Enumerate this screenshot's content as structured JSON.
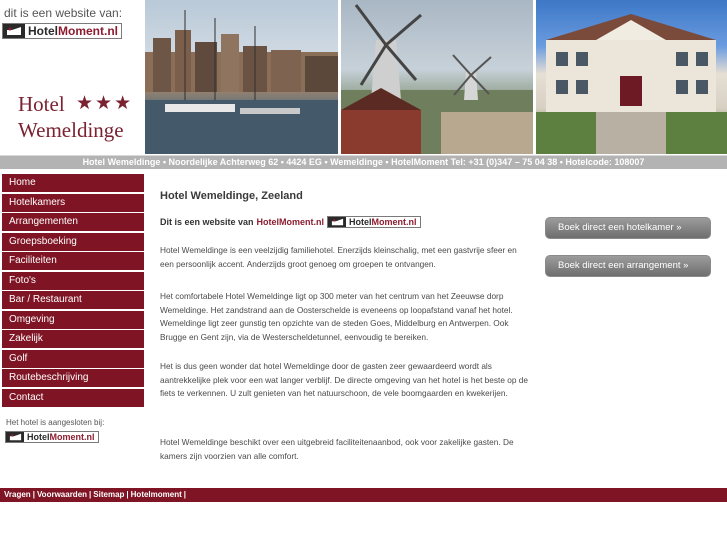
{
  "header": {
    "tagline": "dit is een website van:",
    "logo": {
      "part_a": "Hotel",
      "part_b": "Moment.nl"
    },
    "hotel_name": "Hotel",
    "hotel_stars": "★★★",
    "hotel_place": "Wemeldinge",
    "address_line": "Hotel Wemeldinge • Noordelijke Achterweg 62 • 4424 EG • Wemeldinge • HotelMoment Tel: +31 (0)347 – 75 04 38 • Hotelcode: 108007"
  },
  "nav": {
    "items": [
      {
        "label": "Home"
      },
      {
        "label": "Hotelkamers"
      },
      {
        "label": "Arrangementen"
      },
      {
        "label": "Groepsboeking"
      },
      {
        "label": "Faciliteiten"
      },
      {
        "label": "Foto's"
      },
      {
        "label": "Bar / Restaurant"
      },
      {
        "label": "Omgeving"
      },
      {
        "label": "Zakelijk"
      },
      {
        "label": "Golf"
      },
      {
        "label": "Routebeschrijving"
      },
      {
        "label": "Contact"
      }
    ],
    "member_text": "Het hotel is aangesloten bij:"
  },
  "main": {
    "title": "Hotel Wemeldinge, Zeeland",
    "intro_text": "Dit is een website van",
    "intro_link": "HotelMoment.nl",
    "paragraphs": [
      "Hotel Wemeldinge is een veelzijdig familiehotel. Enerzijds kleinschalig, met een gastvrije sfeer en een persoonlijk accent. Anderzijds groot genoeg om groepen te ontvangen.",
      "Het comfortabele Hotel Wemeldinge ligt op 300 meter van het centrum van het Zeeuwse dorp Wemeldinge. Het zandstrand aan de Oosterschelde is eveneens op loopafstand vanaf het hotel. Wemeldinge ligt zeer gunstig ten opzichte van de steden Goes, Middelburg en Antwerpen. Ook Brugge en Gent zijn, via de Westerscheldetunnel, eenvoudig te bereiken.",
      "Het is dus geen wonder dat hotel Wemeldinge door de gasten zeer gewaardeerd wordt als aantrekkelijke plek voor een wat langer verblijf. De directe omgeving van het hotel is het beste op de fiets te verkennen. U zult genieten van het natuurschoon, de vele boomgaarden en kwekerijen.",
      "Hotel Wemeldinge beschikt over een uitgebreid faciliteitenaanbod, ook voor zakelijke gasten. De kamers zijn voorzien van alle comfort."
    ]
  },
  "cta": {
    "book_room": "Boek direct een hotelkamer »",
    "book_package": "Boek direct een arrangement »"
  },
  "footer": {
    "links": [
      {
        "label": "Vragen"
      },
      {
        "label": "Voorwaarden"
      },
      {
        "label": "Sitemap"
      },
      {
        "label": "Hotelmoment"
      }
    ],
    "separator": "|"
  },
  "colors": {
    "brand": "#7f1424",
    "accent": "#8c1d30",
    "address_bar": "#b3b3b3",
    "button": "#7e7e7e"
  }
}
